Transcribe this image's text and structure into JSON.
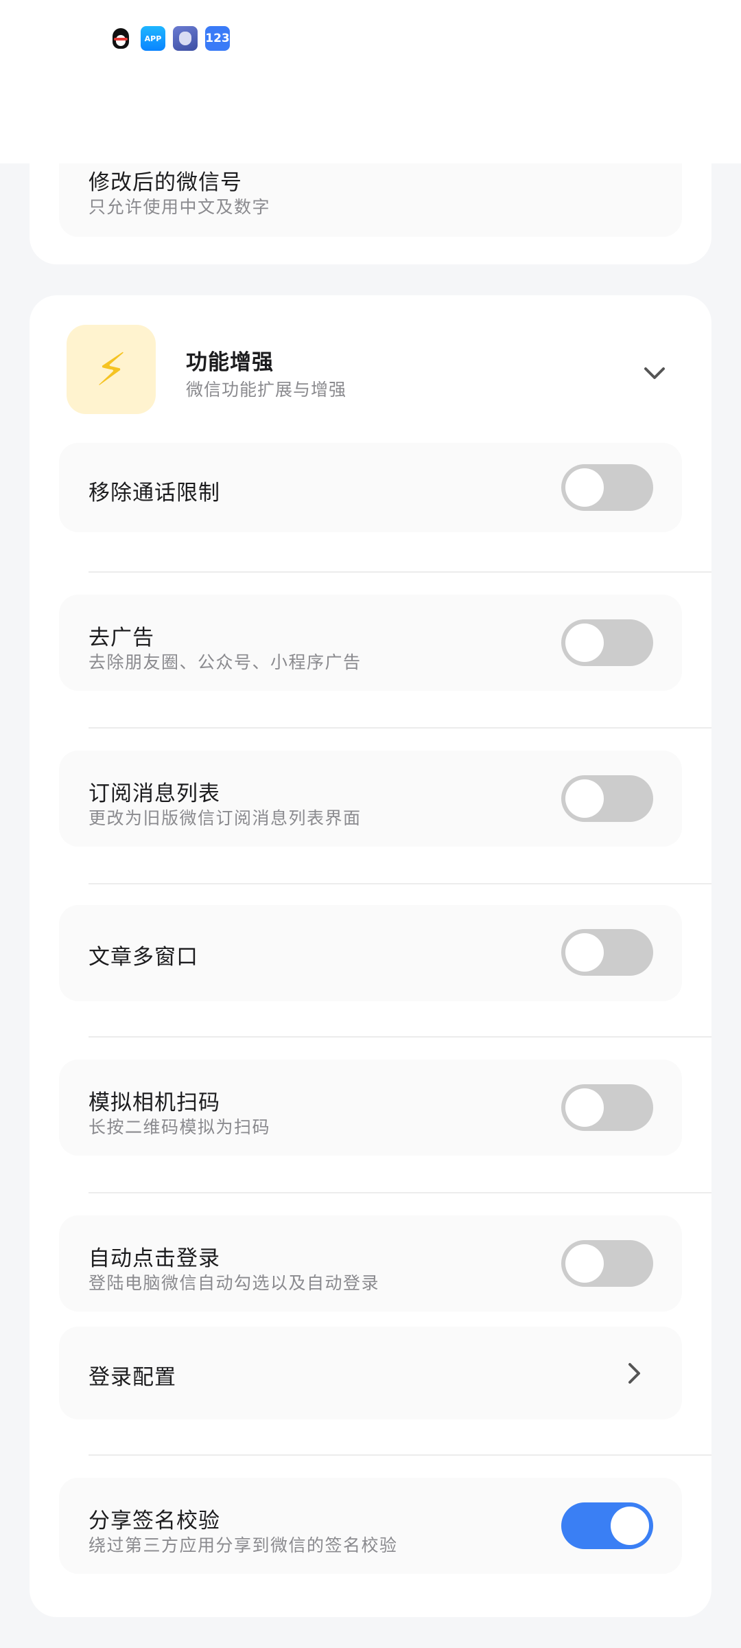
{
  "status_bar": {
    "icons": [
      "qq-penguin-icon",
      "app-store-icon",
      "avatar-app-icon",
      "app-123-icon"
    ],
    "app_badge_text": "APP",
    "num_badge_text": "123"
  },
  "top_card": {
    "row": {
      "title": "修改后的微信号",
      "subtitle": "只允许使用中文及数字"
    }
  },
  "section": {
    "icon": "lightning-icon",
    "icon_glyph": "⚡",
    "title": "功能增强",
    "subtitle": "微信功能扩展与增强",
    "expanded": true
  },
  "items": [
    {
      "title": "移除通话限制",
      "subtitle": "",
      "control": "toggle",
      "on": false
    },
    {
      "title": "去广告",
      "subtitle": "去除朋友圈、公众号、小程序广告",
      "control": "toggle",
      "on": false
    },
    {
      "title": "订阅消息列表",
      "subtitle": "更改为旧版微信订阅消息列表界面",
      "control": "toggle",
      "on": false
    },
    {
      "title": "文章多窗口",
      "subtitle": "",
      "control": "toggle",
      "on": false
    },
    {
      "title": "模拟相机扫码",
      "subtitle": "长按二维码模拟为扫码",
      "control": "toggle",
      "on": false
    },
    {
      "title": "自动点击登录",
      "subtitle": "登陆电脑微信自动勾选以及自动登录",
      "control": "toggle",
      "on": false
    },
    {
      "title": "登录配置",
      "subtitle": "",
      "control": "chevron"
    },
    {
      "title": "分享签名校验",
      "subtitle": "绕过第三方应用分享到微信的签名校验",
      "control": "toggle",
      "on": true
    }
  ],
  "colors": {
    "toggle_on": "#3a7ff4",
    "toggle_off": "#cccccc",
    "page_bg": "#f5f6f8",
    "icon_bg": "#fff3cf",
    "icon_fg": "#f5c323"
  }
}
